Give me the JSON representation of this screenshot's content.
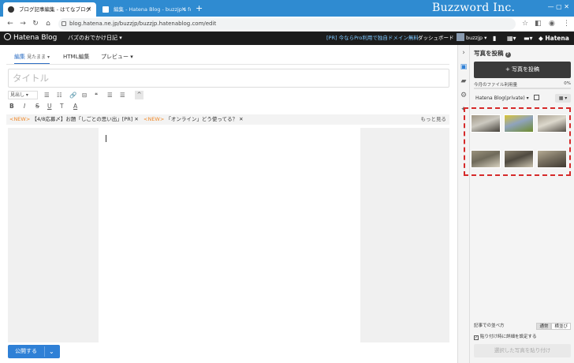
{
  "browser": {
    "tabs": [
      {
        "title": "ブログ記事編集 - はてなブログ",
        "active": true
      },
      {
        "title": "編集 - Hatena Blog - buzzjp's fo",
        "active": false
      }
    ],
    "new_tab": "+",
    "url": "blog.hatena.ne.jp/buzzjp/buzzjp.hatenablog.com/edit",
    "wordmark": "Buzzword Inc.",
    "window_controls": "—  ▢  ✕"
  },
  "hatena_bar": {
    "logo": "Hatena Blog",
    "blog_name": "バズのおでかけ日記 ▾",
    "pro_link": "[PR] 今ならPro利用で独自ドメイン無料",
    "dashboard": "ダッシュボード",
    "user": "buzzjp ▾",
    "brand": "◆ Hatena"
  },
  "editor": {
    "tabs": [
      {
        "label": "編集",
        "sub": "見たまま ▾"
      },
      {
        "label": "HTML編集"
      },
      {
        "label": "プレビュー ▾"
      }
    ],
    "title_placeholder": "タイトル",
    "format_select": "見出し ▾",
    "toolbar_row1": [
      "☰",
      "☷",
      "🔗",
      "⊟",
      "❝",
      "☰",
      "☰"
    ],
    "toolbar_row2": [
      "B",
      "I",
      "S",
      "U",
      "T",
      "A"
    ],
    "collapse": "^",
    "notices": [
      {
        "tag": "<NEW>",
        "text": "【4/8応募〆】お題「しごとの思い出」[PR]"
      },
      {
        "tag": "<NEW>",
        "text": "「オンライン」どう使ってる？"
      }
    ],
    "notice_more": "もっと見る",
    "publish_label": "公開する"
  },
  "photo_panel": {
    "title": "写真を投稿",
    "upload_label": "+ 写真を投稿",
    "usage_label": "今月のファイル利用量",
    "usage_pct": "0%",
    "usage_fraction": 0.0,
    "album": "Hatena Blog(private) ▾",
    "grid_toggle": "▦ ▾",
    "photos": [
      {
        "colors": [
          "#a19785",
          "#45413a",
          "#ccc9c0"
        ]
      },
      {
        "colors": [
          "#d9c434",
          "#6f8c2e",
          "#8fa3bd"
        ]
      },
      {
        "colors": [
          "#a8a090",
          "#555048",
          "#dcd8cc"
        ]
      },
      {
        "colors": [
          "#9a927c",
          "#d8d2c0",
          "#6f6a5a"
        ]
      },
      {
        "colors": [
          "#8c8370",
          "#c9c2ae",
          "#4f4a40"
        ]
      },
      {
        "colors": [
          "#b5ab94",
          "#3f3a32",
          "#7a7262"
        ]
      }
    ],
    "sort_label": "記事での並べ方",
    "sort_options": [
      "通常",
      "横並び"
    ],
    "detail_label": "貼り付け時に詳細を設定する",
    "paste_label": "選択した写真を貼り付け"
  }
}
